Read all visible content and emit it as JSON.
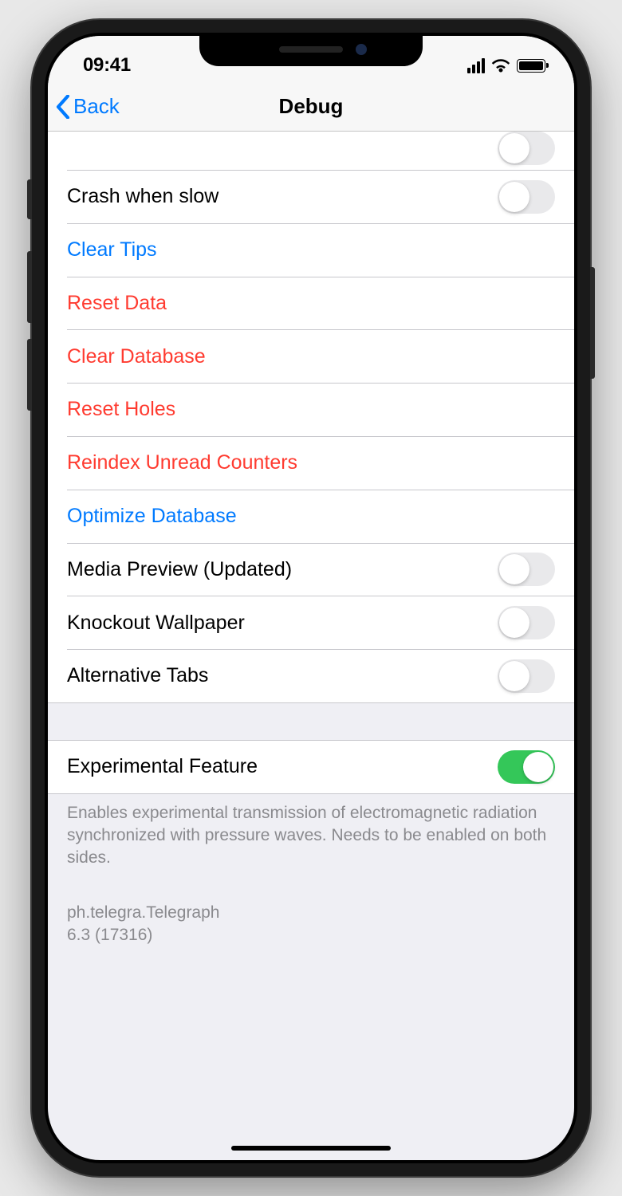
{
  "status": {
    "time": "09:41"
  },
  "nav": {
    "back_label": "Back",
    "title": "Debug"
  },
  "rows": {
    "crash_slow": "Crash when slow",
    "clear_tips": "Clear Tips",
    "reset_data": "Reset Data",
    "clear_database": "Clear Database",
    "reset_holes": "Reset Holes",
    "reindex_unread": "Reindex Unread Counters",
    "optimize_database": "Optimize Database",
    "media_preview": "Media Preview (Updated)",
    "knockout_wallpaper": "Knockout Wallpaper",
    "alternative_tabs": "Alternative Tabs",
    "experimental_feature": "Experimental Feature"
  },
  "footer": {
    "description": "Enables experimental transmission of electromagnetic radiation synchronized with pressure waves. Needs to be enabled on both sides.",
    "bundle_id": "ph.telegra.Telegraph",
    "version": "6.3 (17316)"
  }
}
